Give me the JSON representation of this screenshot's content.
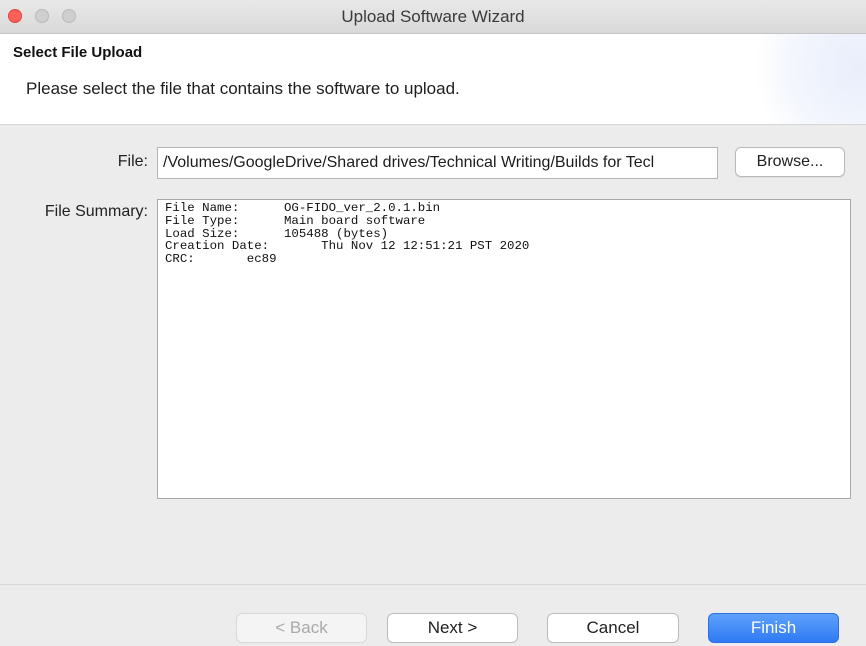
{
  "window": {
    "title": "Upload Software Wizard"
  },
  "header": {
    "title": "Select File Upload",
    "description": "Please select the file that contains the software to upload."
  },
  "form": {
    "file_label": "File:",
    "file_value": "/Volumes/GoogleDrive/Shared drives/Technical Writing/Builds for Tecl",
    "browse_label": "Browse...",
    "summary_label": "File Summary:",
    "summary_lines": [
      "File Name:      OG-FIDO_ver_2.0.1.bin",
      "File Type:      Main board software",
      "Load Size:      105488 (bytes)",
      "Creation Date:       Thu Nov 12 12:51:21 PST 2020",
      "CRC:       ec89"
    ]
  },
  "footer": {
    "back_label": "< Back",
    "next_label": "Next >",
    "cancel_label": "Cancel",
    "finish_label": "Finish"
  },
  "colors": {
    "accent": "#2f7af5",
    "close": "#fe5f57"
  },
  "icons": {
    "close": "close-traffic-light",
    "minimize": "minimize-traffic-light",
    "maximize": "maximize-traffic-light"
  }
}
